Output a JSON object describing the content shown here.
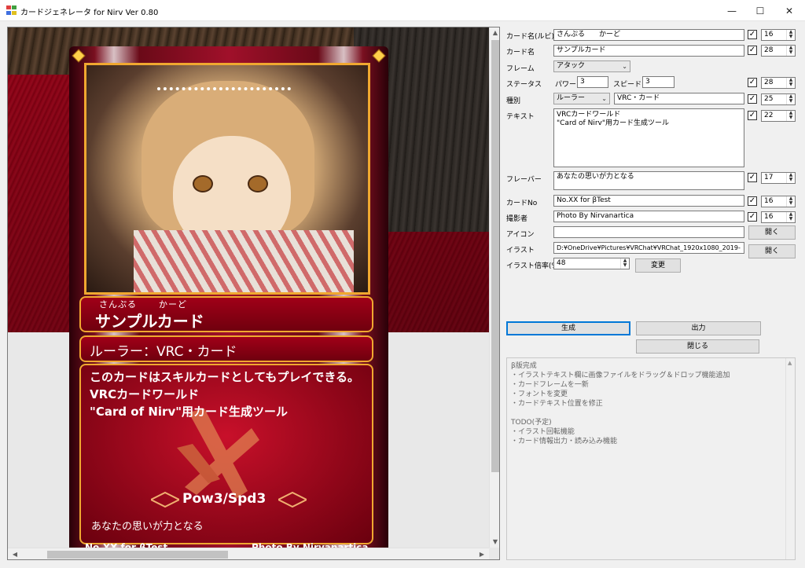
{
  "window": {
    "title": "カードジェネレータ for Nirv Ver 0.80",
    "minimize": "—",
    "maximize": "☐",
    "close": "✕"
  },
  "card": {
    "ruby_parts": [
      "さんぷる",
      "かーど"
    ],
    "name": "サンプルカード",
    "type_line": "ルーラー：VRC・カード",
    "text": "このカードはスキルカードとしてもプレイできる。\nVRCカードワールド\n\"Card of Nirv\"用カード生成ツール",
    "stats": "Pow3/Spd3",
    "flavor": "あなたの思いが力となる",
    "card_no": "No.XX  for βTest",
    "photo_by": "Photo By Nirvanartica"
  },
  "form": {
    "ruby": {
      "label": "カード名(ルビ)",
      "value": "さんぷる　　かーど",
      "checked": "✓",
      "size": "16"
    },
    "name": {
      "label": "カード名",
      "value": "サンプルカード",
      "checked": "✓",
      "size": "28"
    },
    "frame": {
      "label": "フレーム",
      "value": "アタック"
    },
    "status": {
      "label": "ステータス",
      "power_label": "パワー",
      "power": "3",
      "speed_label": "スピード",
      "speed": "3",
      "checked": "✓",
      "size": "28"
    },
    "kind": {
      "label": "種別",
      "value": "ルーラー",
      "sub": "VRC・カード",
      "checked": "✓",
      "size": "25"
    },
    "text": {
      "label": "テキスト",
      "value": "VRCカードワールド\n\"Card of Nirv\"用カード生成ツール",
      "checked": "✓",
      "size": "22"
    },
    "flavor": {
      "label": "フレーバー",
      "value": "あなたの思いが力となる",
      "checked": "✓",
      "size": "17"
    },
    "card_no": {
      "label": "カードNo",
      "value": "No.XX  for βTest",
      "checked": "✓",
      "size": "16"
    },
    "photographer": {
      "label": "撮影者",
      "value": "Photo By Nirvanartica",
      "checked": "✓",
      "size": "16"
    },
    "icon": {
      "label": "アイコン",
      "value": "",
      "button": "開く"
    },
    "illust": {
      "label": "イラスト",
      "value": "D:¥OneDrive¥Pictures¥VRChat¥VRChat_1920x1080_2019-",
      "button": "開く"
    },
    "scale": {
      "label": "イラスト倍率(%)",
      "value": "48",
      "button": "変更"
    }
  },
  "buttons": {
    "generate": "生成",
    "output": "出力",
    "close": "閉じる"
  },
  "log": "β版完成\n・イラストテキスト欄に画像ファイルをドラッグ＆ドロップ機能追加\n・カードフレームを一新\n・フォントを変更\n・カードテキスト位置を修正\n\nTODO(予定)\n・イラスト回転機能\n・カード情報出力・読み込み機能"
}
